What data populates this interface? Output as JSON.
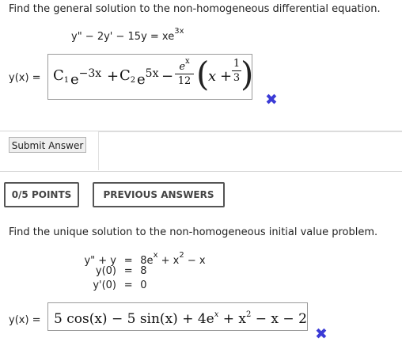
{
  "question1": {
    "prompt": "Find the general solution to the non-homogeneous differential equation.",
    "equation": {
      "lhs": "y\" − 2y' − 15y = xe",
      "exp": "3x"
    },
    "answer_label": "y(x) =",
    "answer": {
      "c1": "C",
      "c1_sub": "1",
      "e1": "e",
      "e1_exp": "−3x",
      "plus1": "+",
      "c2": "C",
      "c2_sub": "2",
      "e2": "e",
      "e2_exp": "5x",
      "minus": "−",
      "frac1_num_base": "e",
      "frac1_num_exp": "x",
      "frac1_den": "12",
      "open_paren": "(",
      "x": "x",
      "plus2": "+",
      "frac2_num": "1",
      "frac2_den": "3",
      "close_paren": ")"
    },
    "status_icon": "✖"
  },
  "submit_label": "Submit Answer",
  "points_label": "0/5 POINTS",
  "previous_answers_label": "PREVIOUS ANSWERS",
  "question2": {
    "prompt": "Find the unique solution to the non-homogeneous initial value problem.",
    "line1": {
      "lhs": "y\" + y",
      "eq": "=",
      "rhs_a": "8e",
      "rhs_a_exp": "x",
      "rhs_b": " + x",
      "rhs_b_exp": "2",
      "rhs_c": " − x"
    },
    "line2": {
      "lhs": "y(0)",
      "eq": "=",
      "rhs": "8"
    },
    "line3": {
      "lhs": "y'(0)",
      "eq": "=",
      "rhs": "0"
    },
    "answer_label": "y(x) =",
    "answer": {
      "part1": "5 cos(x) − 5 sin(x) + 4e",
      "exp1": "x",
      "part2": " + x",
      "exp2": "2",
      "part3": " − x − 2"
    },
    "status_icon": "✖"
  },
  "colors": {
    "mark": "#3b3bd6",
    "border": "#9a9a9a"
  }
}
